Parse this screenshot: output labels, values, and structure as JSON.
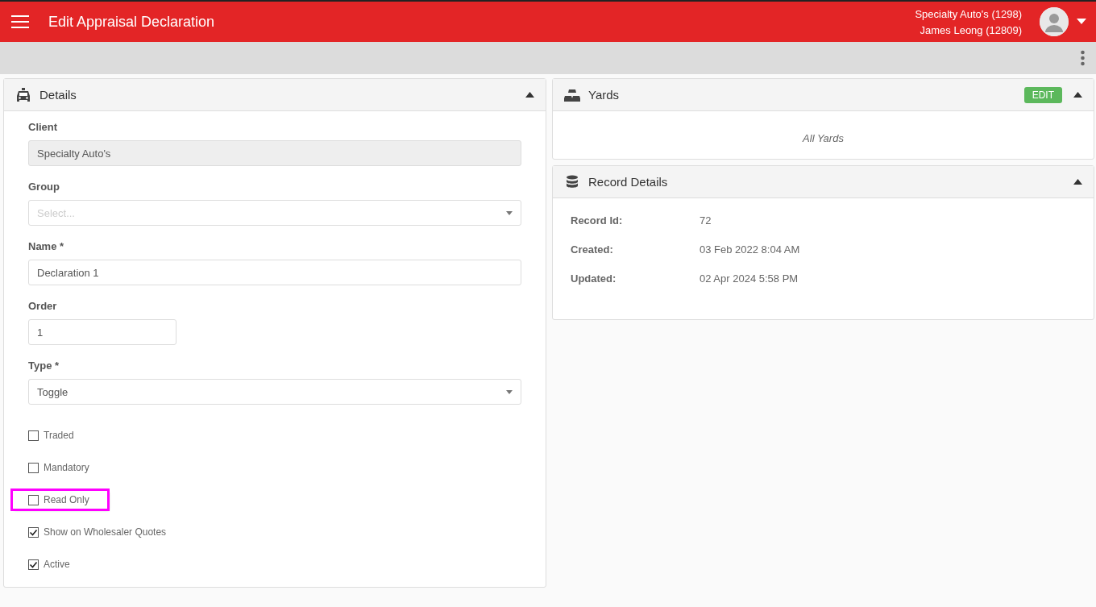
{
  "header": {
    "title": "Edit Appraisal Declaration",
    "account": "Specialty Auto's (1298)",
    "user": "James Leong (12809)"
  },
  "details": {
    "title": "Details",
    "expanded": true,
    "fields": [
      {
        "kind": "readonly",
        "label": "Client",
        "value": "Specialty Auto's"
      },
      {
        "kind": "select",
        "label": "Group",
        "placeholder": "Select..."
      },
      {
        "kind": "text",
        "label": "Name *",
        "value": "Declaration 1"
      },
      {
        "kind": "short",
        "label": "Order",
        "value": "1"
      },
      {
        "kind": "select",
        "label": "Type *",
        "value": "Toggle"
      }
    ],
    "checkboxes": [
      {
        "label": "Traded",
        "checked": false,
        "highlighted": false
      },
      {
        "label": "Mandatory",
        "checked": false,
        "highlighted": false
      },
      {
        "label": "Read Only",
        "checked": false,
        "highlighted": true
      },
      {
        "label": "Show on Wholesaler Quotes",
        "checked": true,
        "highlighted": false
      },
      {
        "label": "Active",
        "checked": true,
        "highlighted": false
      }
    ]
  },
  "yards": {
    "title": "Yards",
    "edit_button": "EDIT",
    "expanded": true,
    "summary": "All Yards"
  },
  "record_details": {
    "title": "Record Details",
    "expanded": true,
    "rows": [
      {
        "label": "Record Id:",
        "value": "72"
      },
      {
        "label": "Created:",
        "value": "03 Feb 2022 8:04 AM"
      },
      {
        "label": "Updated:",
        "value": "02 Apr 2024 5:58 PM"
      }
    ]
  }
}
